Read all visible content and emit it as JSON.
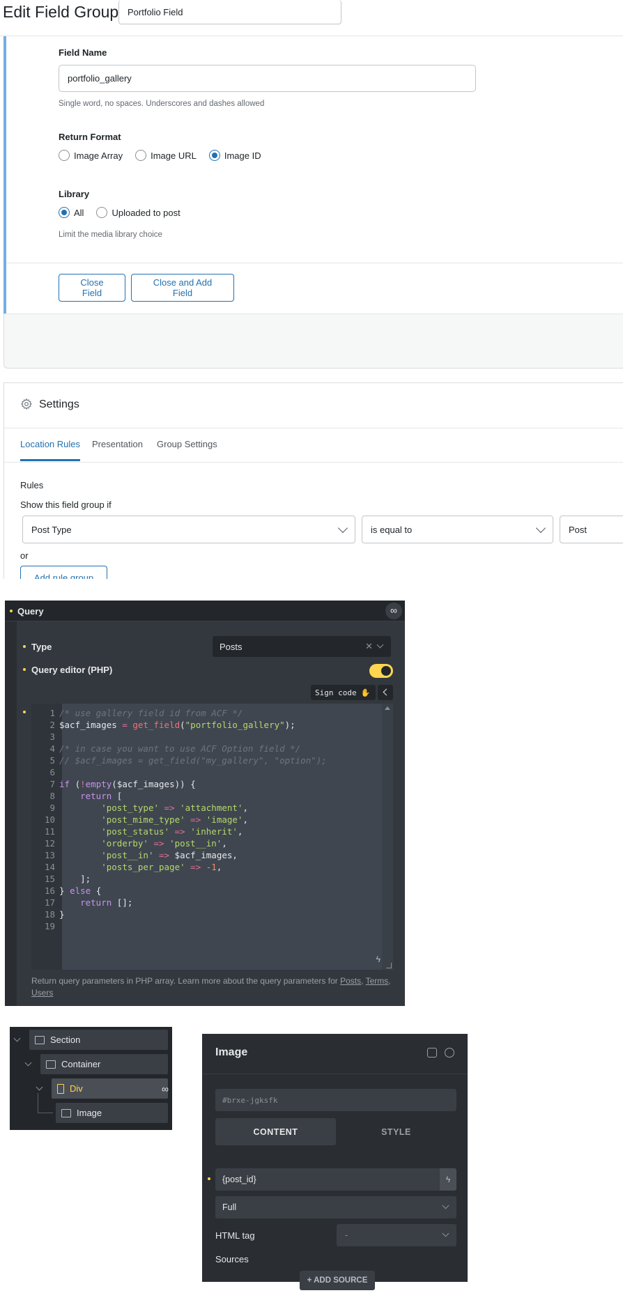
{
  "acf": {
    "page_title": "Edit Field Group",
    "title_input_value": "Portfolio Field",
    "field_name": {
      "label": "Field Name",
      "value": "portfolio_gallery",
      "help": "Single word, no spaces. Underscores and dashes allowed"
    },
    "return_format": {
      "label": "Return Format",
      "options": [
        "Image Array",
        "Image URL",
        "Image ID"
      ],
      "selected": "Image ID"
    },
    "library": {
      "label": "Library",
      "options": [
        "All",
        "Uploaded to post"
      ],
      "selected": "All",
      "help": "Limit the media library choice"
    },
    "buttons": {
      "close_field": "Close Field",
      "close_and_add": "Close and Add Field"
    },
    "accent_color": "#2271b1",
    "panel_border_color": "#72aee6"
  },
  "settings": {
    "title": "Settings",
    "tabs": [
      "Location Rules",
      "Presentation",
      "Group Settings"
    ],
    "active_tab": "Location Rules",
    "rules_label": "Rules",
    "show_if_label": "Show this field group if",
    "rule": {
      "param": "Post Type",
      "operator": "is equal to",
      "value": "Post"
    },
    "or_label": "or",
    "add_rule_group": "Add rule group"
  },
  "query": {
    "title": "Query",
    "type_label": "Type",
    "type_value": "Posts",
    "editor_label": "Query editor (PHP)",
    "editor_enabled": true,
    "sign_code_label": "Sign code",
    "code_lines": [
      "/* use gallery field id from ACF */",
      "$acf_images = get_field(\"portfolio_gallery\");",
      "",
      "/* in case you want to use ACF Option field */",
      "// $acf_images = get_field(\"my_gallery\", \"option\");",
      "",
      "if (!empty($acf_images)) {",
      "    return [",
      "        'post_type' => 'attachment',",
      "        'post_mime_type' => 'image',",
      "        'post_status' => 'inherit',",
      "        'orderby' => 'post__in',",
      "        'post__in' => $acf_images,",
      "        'posts_per_page' => -1,",
      "    ];",
      "} else {",
      "    return [];",
      "}",
      ""
    ],
    "help_text": "Return query parameters in PHP array. Learn more about the query parameters for",
    "help_links": [
      "Posts",
      "Terms",
      "Users"
    ],
    "accent_color": "#ffd64f"
  },
  "structure": {
    "items": [
      {
        "label": "Section",
        "icon": "section-icon"
      },
      {
        "label": "Container",
        "icon": "container-icon"
      },
      {
        "label": "Div",
        "icon": "div-icon",
        "active": true
      },
      {
        "label": "Image",
        "icon": "image-icon"
      }
    ]
  },
  "image_panel": {
    "title": "Image",
    "element_id": "#brxe-jgksfk",
    "tabs": [
      "CONTENT",
      "STYLE"
    ],
    "active_tab": "CONTENT",
    "image_source": "{post_id}",
    "size": "Full",
    "html_tag_label": "HTML tag",
    "html_tag_value": "-",
    "sources_label": "Sources",
    "add_source": "+ ADD SOURCE"
  }
}
